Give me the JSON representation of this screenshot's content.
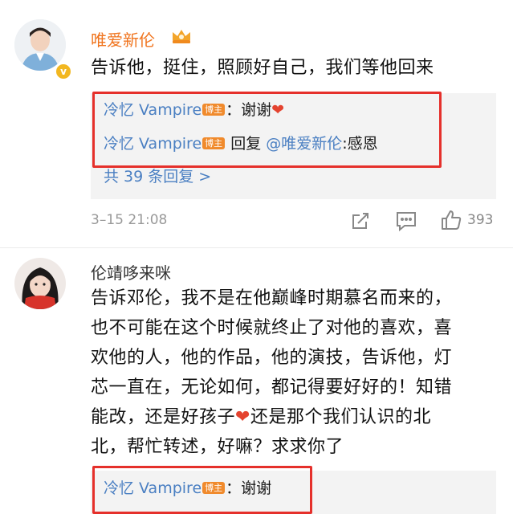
{
  "comments": [
    {
      "username": "唯爱新伦",
      "text": "告诉他，挺住，照顾好自己，我们等他回来",
      "replies": [
        {
          "user": "冷忆 Vampire",
          "badge": "博主",
          "sep": "：",
          "text": "谢谢",
          "emoji": "❤"
        },
        {
          "user": "冷忆 Vampire",
          "badge": "博主",
          "prefix": "回复 ",
          "mention": "@唯爱新伦",
          "text": ":感恩"
        }
      ],
      "more_replies": "共 39 条回复 >",
      "timestamp": "3–15 21:08",
      "likes": "393"
    },
    {
      "username": "伦靖哆来咪",
      "text_lines": [
        "告诉邓伦，我不是在他巅峰时期慕名而来的，",
        "也不可能在这个时候就终止了对他的喜欢，喜",
        "欢他的人，他的作品，他的演技，告诉他，灯",
        "芯一直在，无论如何，都记得要好好的！知错",
        "能改，还是好孩子",
        "还是那个我们认识的北",
        "北，帮忙转述，好嘛？求求你了"
      ],
      "emoji": "❤",
      "replies": [
        {
          "user": "冷忆 Vampire",
          "badge": "博主",
          "sep": "：",
          "text": "谢谢"
        }
      ]
    }
  ],
  "colors": {
    "username_orange": "#f0741e",
    "link_blue": "#4a7fc2",
    "highlight_red": "#e5302b",
    "badge_orange": "#f08a2c"
  }
}
